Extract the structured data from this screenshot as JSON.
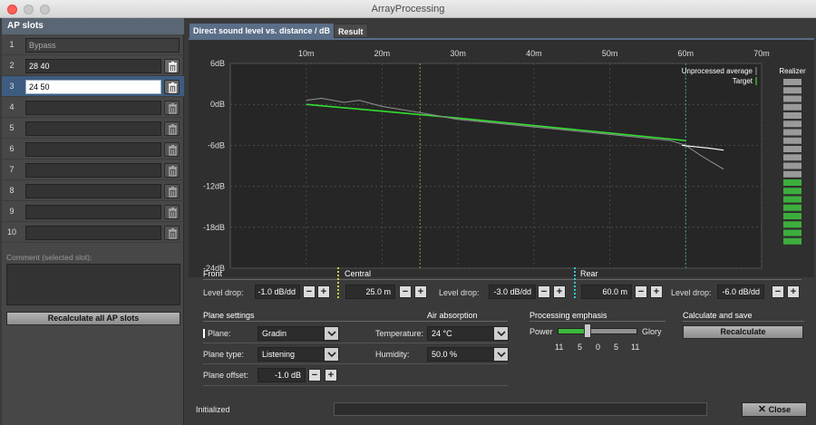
{
  "window": {
    "title": "ArrayProcessing"
  },
  "left": {
    "header": "AP slots",
    "slots": [
      {
        "num": "1",
        "value": "Bypass"
      },
      {
        "num": "2",
        "value": "28 40"
      },
      {
        "num": "3",
        "value": "24 50"
      },
      {
        "num": "4",
        "value": ""
      },
      {
        "num": "5",
        "value": ""
      },
      {
        "num": "6",
        "value": ""
      },
      {
        "num": "7",
        "value": ""
      },
      {
        "num": "8",
        "value": ""
      },
      {
        "num": "9",
        "value": ""
      },
      {
        "num": "10",
        "value": ""
      }
    ],
    "comment_label": "Comment (selected slot):",
    "comment_value": "",
    "recalc_all": "Recalculate all AP slots"
  },
  "tabs": [
    {
      "label": "Direct sound level vs. distance / dB",
      "active": true
    },
    {
      "label": "Result",
      "active": false
    }
  ],
  "chart_data": {
    "type": "line",
    "x_ticks": [
      "10m",
      "20m",
      "30m",
      "40m",
      "50m",
      "60m",
      "70m"
    ],
    "y_ticks": [
      "6dB",
      "0dB",
      "-6dB",
      "-12dB",
      "-18dB",
      "-24dB"
    ],
    "xlim": [
      0,
      70
    ],
    "ylim": [
      -24,
      6
    ],
    "legend": [
      "Unprocessed average",
      "Target"
    ],
    "vertical_markers": [
      {
        "name": "Central",
        "x": 25,
        "color": "#c8c832"
      },
      {
        "name": "Rear",
        "x": 60,
        "color": "#3ac8c8"
      }
    ],
    "series": [
      {
        "color": "#33dd33",
        "x": [
          10,
          20,
          30,
          40,
          50,
          60
        ],
        "y": [
          0,
          -1,
          -2,
          -3.1,
          -4.2,
          -5.3
        ]
      },
      {
        "color": "#8a8a8a",
        "x": [
          10,
          12,
          15,
          17,
          20,
          25,
          30,
          40,
          50,
          58,
          60,
          62,
          65
        ],
        "y": [
          0.6,
          0.9,
          0.3,
          0.6,
          -0.3,
          -1.2,
          -2.2,
          -3.3,
          -4.4,
          -5.3,
          -6,
          -7.5,
          -9.5
        ]
      },
      {
        "color": "#ffffff",
        "x": [
          59.5,
          63,
          65
        ],
        "y": [
          -6,
          -6.4,
          -6.7
        ]
      }
    ],
    "realizer": {
      "label": "Realizer",
      "segments": 20,
      "active": 8,
      "active_color": "#3cae3c",
      "inactive_color": "#9a9a9a"
    }
  },
  "bands": {
    "front_label": "Front",
    "central_label": "Central",
    "rear_label": "Rear",
    "level_drop_label": "Level drop:",
    "front_drop": "-1.0 dB/dd",
    "central_distance": "25.0 m",
    "central_drop": "-3.0 dB/dd",
    "rear_distance": "60.0 m",
    "rear_drop": "-6.0 dB/dd"
  },
  "plane": {
    "header": "Plane settings",
    "plane_label": "Plane:",
    "plane_value": "Gradin",
    "type_label": "Plane type:",
    "type_value": "Listening",
    "offset_label": "Plane offset:",
    "offset_value": "-1.0 dB"
  },
  "air": {
    "header": "Air absorption",
    "temp_label": "Temperature:",
    "temp_value": "24 °C",
    "humidity_label": "Humidity:",
    "humidity_value": "50.0 %"
  },
  "emphasis": {
    "header": "Processing emphasis",
    "left_label": "Power",
    "right_label": "Glory",
    "ticks": [
      "11",
      "5",
      "0",
      "5",
      "11"
    ],
    "value_fraction": 0.38
  },
  "calc": {
    "header": "Calculate and save",
    "button": "Recalculate"
  },
  "footer": {
    "status": "Initialized",
    "close": "Close"
  },
  "symbols": {
    "plus": "+",
    "minus": "−"
  }
}
